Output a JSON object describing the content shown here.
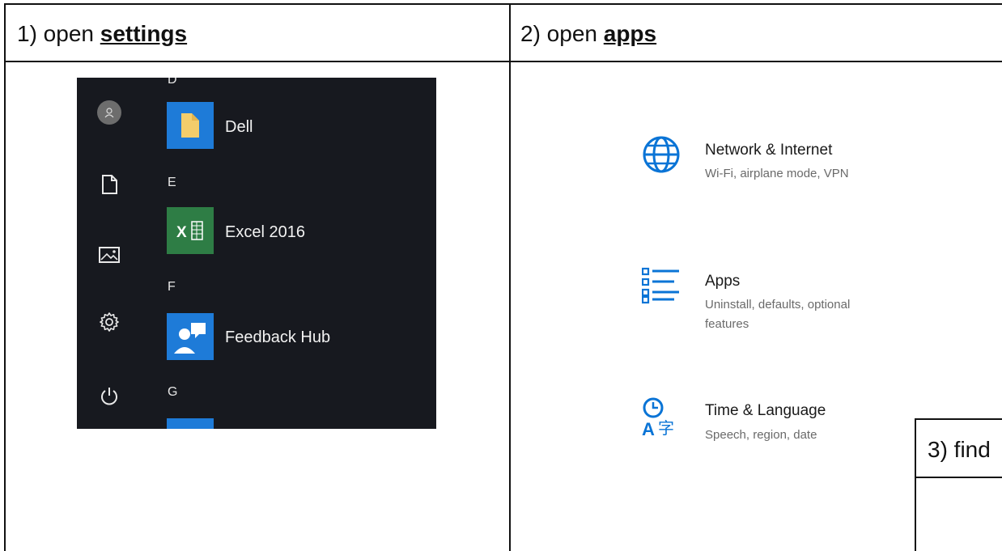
{
  "steps": [
    {
      "prefix": "1) open ",
      "keyword": "settings"
    },
    {
      "prefix": "2) open ",
      "keyword": "apps"
    },
    {
      "prefix": "3) find",
      "keyword": ""
    }
  ],
  "start_menu": {
    "letters": {
      "d": "D",
      "e": "E",
      "f": "F",
      "g": "G"
    },
    "apps": [
      {
        "label": "Dell",
        "icon": "dell-folder-icon",
        "tile_color": "#1e7bd8"
      },
      {
        "label": "Excel 2016",
        "icon": "excel-icon",
        "tile_color": "#2e7d45"
      },
      {
        "label": "Feedback Hub",
        "icon": "feedback-hub-icon",
        "tile_color": "#1e7bd8"
      }
    ],
    "rail_icons": [
      "avatar-icon",
      "document-icon",
      "pictures-icon",
      "settings-gear-icon",
      "power-icon"
    ]
  },
  "settings_items": [
    {
      "title": "Network & Internet",
      "subtitle": "Wi-Fi, airplane mode, VPN",
      "icon": "globe-icon"
    },
    {
      "title": "Apps",
      "subtitle_line1": "Uninstall, defaults, optional",
      "subtitle_line2": "features",
      "icon": "apps-list-icon"
    },
    {
      "title": "Time & Language",
      "subtitle": "Speech, region, date",
      "icon": "time-language-icon"
    }
  ],
  "colors": {
    "accent": "#0a74d6",
    "start_bg": "#17191f",
    "excel_green": "#2e7d45"
  }
}
